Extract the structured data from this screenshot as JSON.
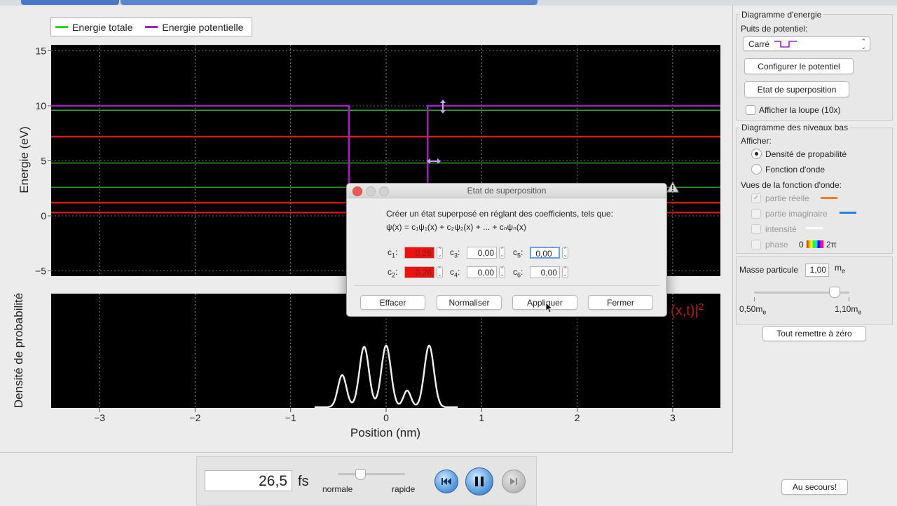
{
  "legend": {
    "total_label": "Energie totale",
    "potential_label": "Energie potentielle",
    "total_color": "#2fd22f",
    "potential_color": "#a020c0"
  },
  "energy_plot": {
    "ylabel": "Energie (eV)",
    "yticks": [
      "15",
      "10",
      "5",
      "0",
      "−5"
    ],
    "total_energy_levels_eV": [
      9.6,
      7.2,
      4.8,
      2.6,
      1.2,
      0.3
    ],
    "red_line_levels_eV": [
      7.2,
      1.2,
      0.3
    ],
    "green_line_levels_eV": [
      9.6,
      4.8,
      2.6
    ],
    "potential_well": {
      "left_nm": -0.5,
      "right_nm": 0.5,
      "outside_eV": 10,
      "inside_eV": 0
    }
  },
  "prob_plot": {
    "ylabel": "Densité de probabilité",
    "xlabel": "Position (nm)",
    "xticks": [
      "−3",
      "−2",
      "−1",
      "0",
      "1",
      "2",
      "3"
    ],
    "formula_fragment": "(x,t)|",
    "formula_sup": "2"
  },
  "right_panel": {
    "diagram_title": "Diagramme d'energie",
    "well_label": "Puits de potentiel:",
    "well_value": "Carré",
    "configure_button": "Configurer le potentiel",
    "superposition_button": "Etat de superposition",
    "loupe_label": "Afficher la loupe (10x)",
    "low_levels_title": "Diagramme des niveaux bas",
    "show_label": "Afficher:",
    "radio_density": "Densité de propabilité",
    "radio_wave": "Fonction d'onde",
    "views_label": "Vues de la fonction d'onde:",
    "real_part": "partie réelle",
    "imag_part": "partie imaginaire",
    "intensity": "intensité",
    "phase": "phase",
    "phase_min": "0",
    "phase_max": "2π",
    "real_color": "#f08020",
    "imag_color": "#2a7fdc",
    "mass_label": "Masse particule",
    "mass_value": "1,00",
    "mass_unit": "m",
    "mass_unit_sub": "e",
    "slider_min": "0,50m",
    "slider_min_sub": "e",
    "slider_max": "1,10m",
    "slider_max_sub": "e",
    "reset_button": "Tout remettre à zéro",
    "help_button": "Au secours!"
  },
  "dialog": {
    "title": "Etat de superposition",
    "description": "Créer un état superposé en réglant des coefficients, tels que:",
    "formula": "ψ(x) = c₁ψ₁(x) + c₂ψ₂(x) + ... + cₙψₙ(x)",
    "coefficients": [
      {
        "label": "c",
        "sub": "1",
        "value": "0,26"
      },
      {
        "label": "c",
        "sub": "2",
        "value": "0,26"
      },
      {
        "label": "c",
        "sub": "3",
        "value": "0,00"
      },
      {
        "label": "c",
        "sub": "4",
        "value": "0,00"
      },
      {
        "label": "c",
        "sub": "5",
        "value": "0,00"
      },
      {
        "label": "c",
        "sub": "6",
        "value": "0,00"
      }
    ],
    "clear_button": "Effacer",
    "normalize_button": "Normaliser",
    "apply_button": "Appliquer",
    "close_button": "Fermer"
  },
  "playback": {
    "time_value": "26,5",
    "time_unit": "fs",
    "speed_normal": "normale",
    "speed_fast": "rapide"
  }
}
